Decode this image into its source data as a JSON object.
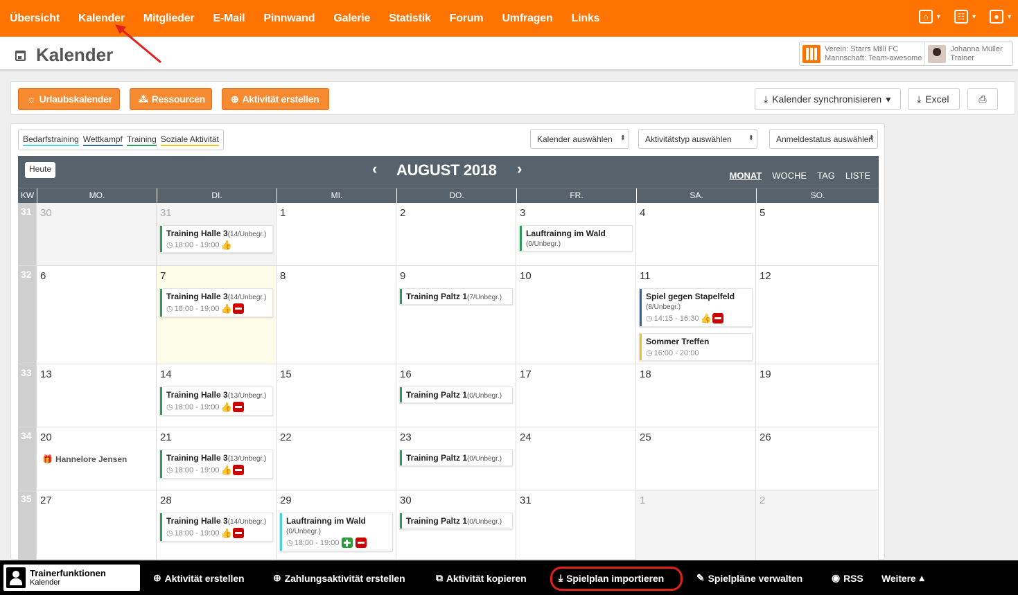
{
  "topnav": {
    "items": [
      "Übersicht",
      "Kalender",
      "Mitglieder",
      "E-Mail",
      "Pinnwand",
      "Galerie",
      "Statistik",
      "Forum",
      "Umfragen",
      "Links"
    ]
  },
  "header": {
    "title": "Kalender",
    "club_line1": "Verein: Starrs Milli FC",
    "club_line2": "Mannschaft: Team-awesome",
    "user_name": "Johanna Müller",
    "user_role": "Trainer"
  },
  "toolbar": {
    "urlaub": "Urlaubskalender",
    "ressourcen": "Ressourcen",
    "aktivitaet": "Aktivität erstellen",
    "sync": "Kalender synchronisieren",
    "excel": "Excel"
  },
  "legend": [
    "Bedarfstraining",
    "Wettkampf",
    "Training",
    "Soziale Aktivität"
  ],
  "legend_colors": [
    "#4fd1d9",
    "#2c6a9e",
    "#2a9d5a",
    "#f0c020"
  ],
  "filters": {
    "kalender": "Kalender auswählen",
    "typ": "Aktivitätstyp auswählen",
    "status": "Anmeldestatus auswählen"
  },
  "calendar": {
    "today_btn": "Heute",
    "month_title": "AUGUST 2018",
    "views": [
      "MONAT",
      "WOCHE",
      "TAG",
      "LISTE"
    ],
    "kw_label": "KW",
    "days": [
      "MO.",
      "DI.",
      "MI.",
      "DO.",
      "FR.",
      "SA.",
      "SO."
    ],
    "weeks": [
      {
        "kw": "31",
        "days": [
          "30",
          "31",
          "1",
          "2",
          "3",
          "4",
          "5"
        ]
      },
      {
        "kw": "32",
        "days": [
          "6",
          "7",
          "8",
          "9",
          "10",
          "11",
          "12"
        ]
      },
      {
        "kw": "33",
        "days": [
          "13",
          "14",
          "15",
          "16",
          "17",
          "18",
          "19"
        ]
      },
      {
        "kw": "34",
        "days": [
          "20",
          "21",
          "22",
          "23",
          "24",
          "25",
          "26"
        ]
      },
      {
        "kw": "35",
        "days": [
          "27",
          "28",
          "29",
          "30",
          "31",
          "1",
          "2"
        ]
      }
    ],
    "birthday": "Hannelore Jensen",
    "events": {
      "w1_di": {
        "title": "Training Halle 3",
        "count": "(14/Unbegr.)",
        "time": "18:00 - 19:00"
      },
      "w1_fr": {
        "title": "Lauftrainng im Wald",
        "count": "(0/Unbegr.)"
      },
      "w2_di": {
        "title": "Training Halle 3",
        "count": "(14/Unbegr.)",
        "time": "18:00 - 19:00"
      },
      "w2_do": {
        "title": "Training Paltz 1",
        "count": "(7/Unbegr.)"
      },
      "w2_sa1": {
        "title": "Spiel gegen Stapelfeld",
        "count": "(8/Unbegr.)",
        "time": "14:15 - 16:30"
      },
      "w2_sa2": {
        "title": "Sommer Treffen",
        "time": "16:00 - 20:00"
      },
      "w3_di": {
        "title": "Training Halle 3",
        "count": "(13/Unbegr.)",
        "time": "18:00 - 19:00"
      },
      "w3_do": {
        "title": "Training Paltz 1",
        "count": "(0/Unbegr.)"
      },
      "w4_di": {
        "title": "Training Halle 3",
        "count": "(13/Unbegr.)",
        "time": "18:00 - 19:00"
      },
      "w4_do": {
        "title": "Training Paltz 1",
        "count": "(0/Unbegr.)"
      },
      "w5_di": {
        "title": "Training Halle 3",
        "count": "(14/Unbegr.)",
        "time": "18:00 - 19:00"
      },
      "w5_mi": {
        "title": "Lauftrainng im Wald",
        "count": "(0/Unbegr.)",
        "time": "18:00 - 19:00"
      },
      "w5_do": {
        "title": "Training Paltz 1",
        "count": "(0/Unbegr.)"
      }
    }
  },
  "bottombar": {
    "trainer_title": "Trainerfunktionen",
    "trainer_sub": "Kalender",
    "items": [
      "Aktivität erstellen",
      "Zahlungsaktivität erstellen",
      "Aktivität kopieren",
      "Spielplan importieren",
      "Spielpläne verwalten",
      "RSS",
      "Weitere"
    ]
  }
}
